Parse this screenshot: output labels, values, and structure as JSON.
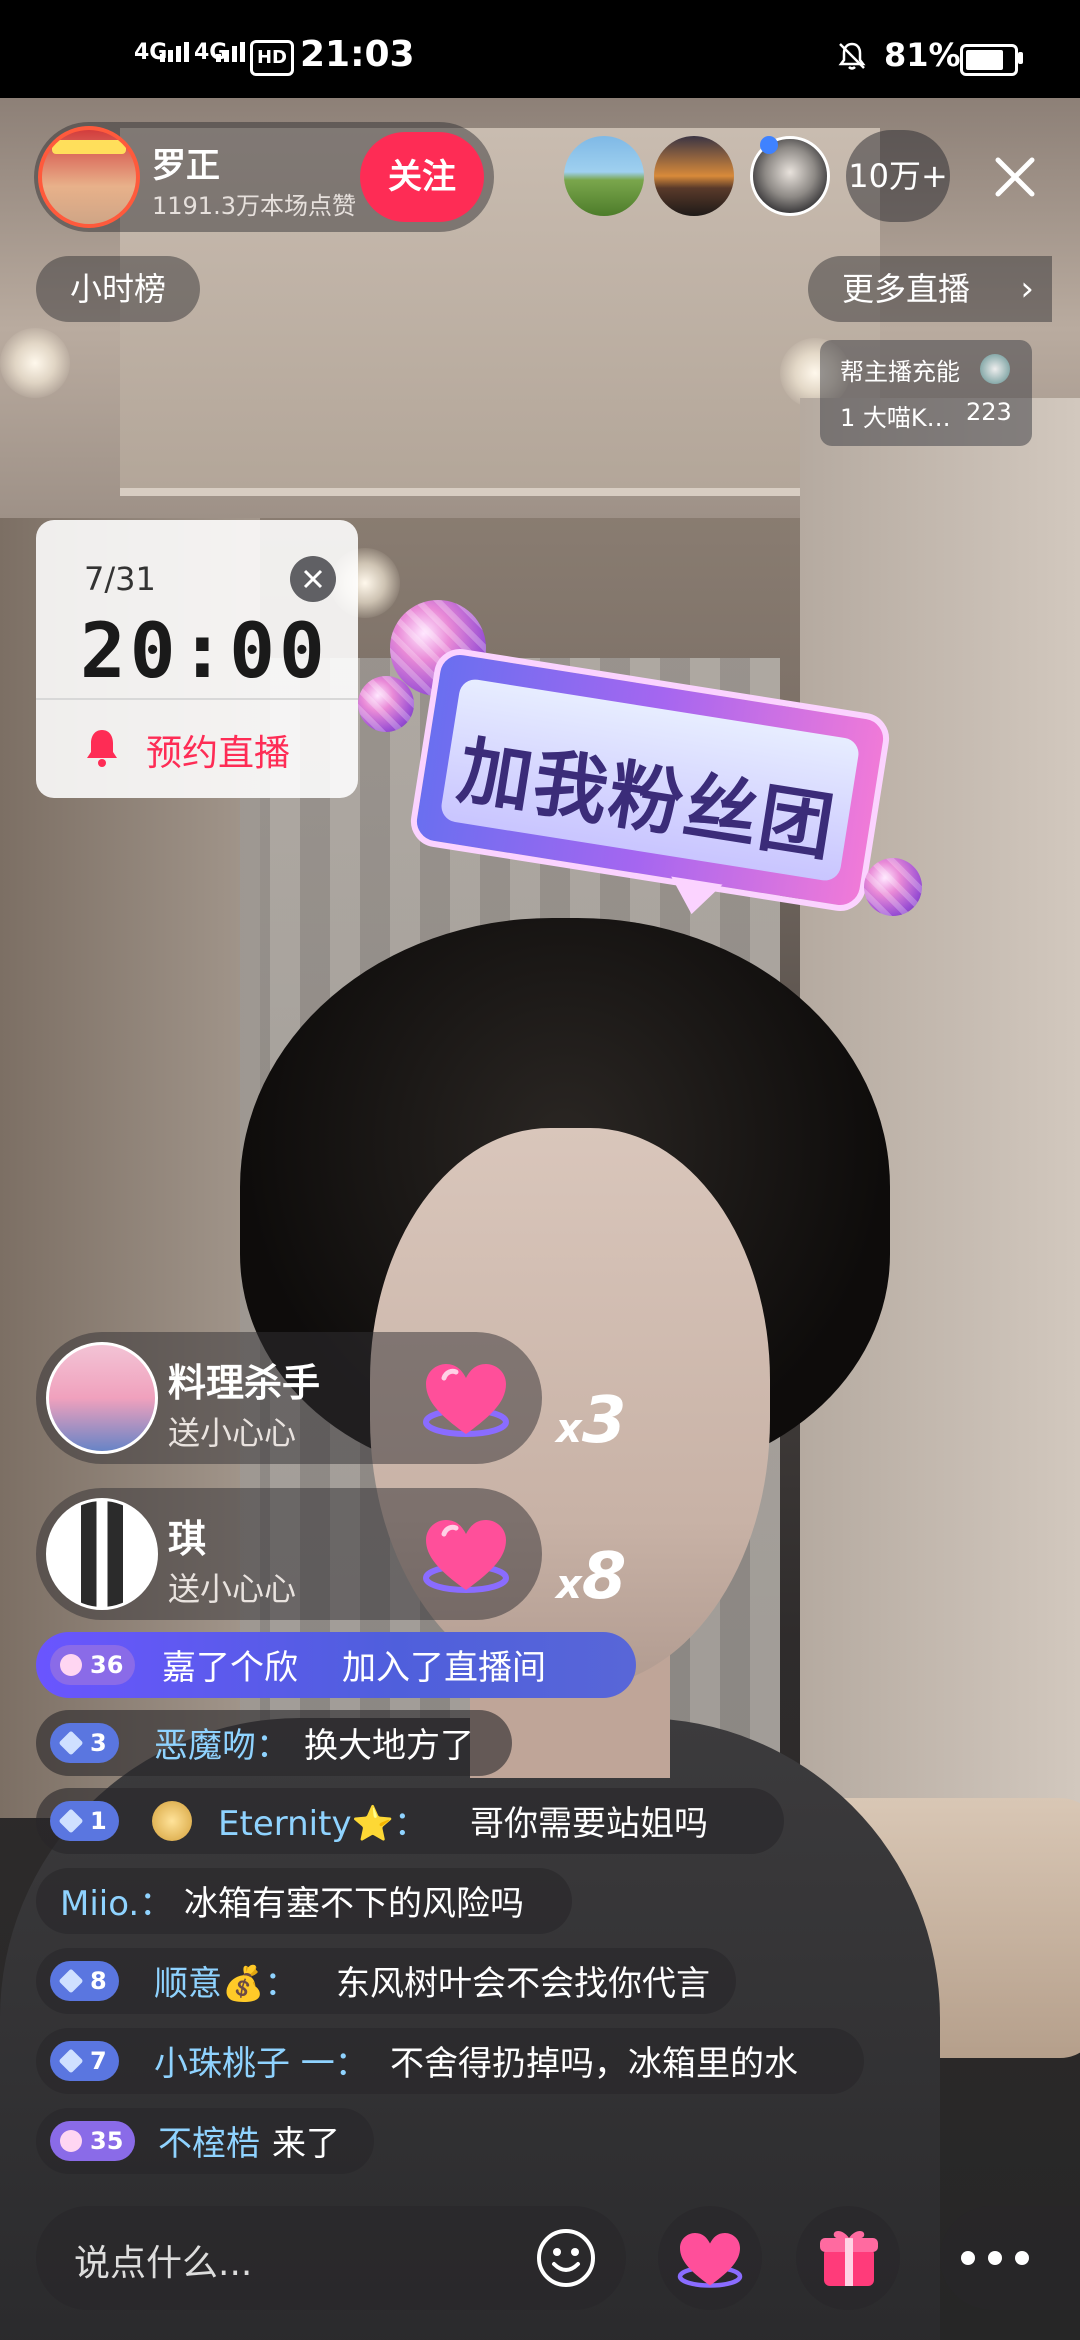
{
  "status_bar": {
    "signal_1": "4G",
    "signal_2": "4G",
    "hd_label": "HD",
    "time": "21:03",
    "battery": "81%",
    "battery_level": 0.81,
    "mute_icon": "bell-off-icon"
  },
  "host": {
    "name": "罗正",
    "likes": "1191.3万本场点赞",
    "follow_label": "关注"
  },
  "viewers": {
    "count": "10万+"
  },
  "top": {
    "hourly_rank": "小时榜",
    "more_live": "更多直播",
    "more_live_arrow": "›",
    "charge_title": "帮主播充能",
    "charge_user": "1 大喵K…",
    "charge_value": "223"
  },
  "schedule": {
    "date": "7/31",
    "time": "20:00",
    "action": "预约直播"
  },
  "fan_club": {
    "text": "加我粉丝团"
  },
  "gifts": [
    {
      "user": "料理杀手",
      "action": "送小心心",
      "x": "x",
      "count": "3"
    },
    {
      "user": "琪",
      "action": "送小心心",
      "x": "x",
      "count": "8"
    }
  ],
  "chat": {
    "join": {
      "level": "36",
      "user": "嘉了个欣",
      "text": "加入了直播间"
    },
    "messages": [
      {
        "level": "3",
        "user": "恶魔吻：",
        "text": "换大地方了"
      },
      {
        "level": "1",
        "user": "Eternity⭐：",
        "text": "哥你需要站姐吗"
      },
      {
        "user": "Miio.：",
        "text": "冰箱有塞不下的风险吗"
      },
      {
        "level": "8",
        "user": "顺意💰：",
        "text": "东风树叶会不会找你代言"
      },
      {
        "level": "7",
        "user": "小珠桃子 一：",
        "text": "不舍得扔掉吗，冰箱里的水"
      }
    ],
    "arrival": {
      "level": "35",
      "user": "不榁梏",
      "text": "来了"
    }
  },
  "bottom": {
    "comment_placeholder": "说点什么..."
  },
  "colors": {
    "accent": "#fe2c55",
    "chat_name": "#8fd3ff",
    "fan_banner_text": "#3b2c79"
  }
}
